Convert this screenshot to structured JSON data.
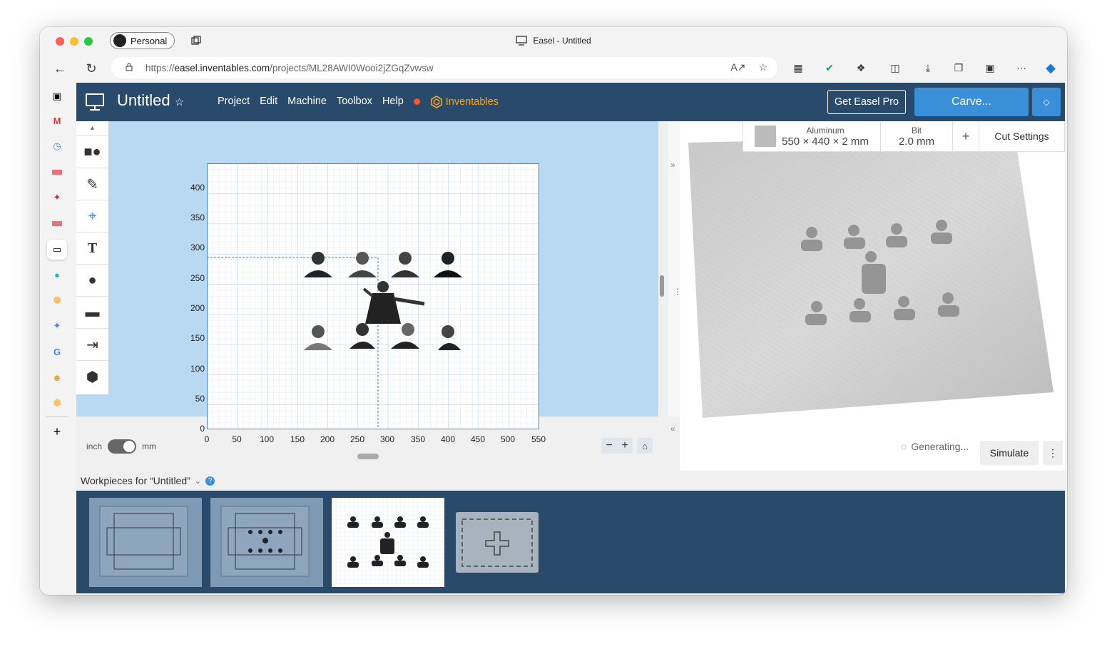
{
  "browser": {
    "window_title": "Easel - Untitled",
    "profile_label": "Personal",
    "url_prefix": "https://",
    "url_host": "easel.inventables.com",
    "url_path": "/projects/ML28AWI0Wooi2jZGqZvwsw"
  },
  "colors": {
    "appbar_bg": "#294a6b",
    "carve_button": "#3a8fd9",
    "canvas_bg": "#b9d8f2",
    "accent_orange": "#f5a623",
    "notification": "#f05a28"
  },
  "app": {
    "project_title": "Untitled",
    "menu": [
      "Project",
      "Edit",
      "Machine",
      "Toolbox",
      "Help"
    ],
    "brand_label": "Inventables",
    "get_pro_label": "Get Easel Pro",
    "carve_label": "Carve..."
  },
  "tools": [
    "shapes-icon",
    "pen-icon",
    "target-icon",
    "text-icon",
    "apple-icon",
    "lego-icon",
    "import-icon",
    "box-icon"
  ],
  "canvas": {
    "y_ticks": [
      "400",
      "350",
      "300",
      "250",
      "200",
      "150",
      "100",
      "50",
      "0"
    ],
    "x_ticks": [
      "0",
      "50",
      "100",
      "150",
      "200",
      "250",
      "300",
      "350",
      "400",
      "450",
      "500",
      "550"
    ],
    "unit_left": "inch",
    "unit_right": "mm",
    "unit_selected": "mm"
  },
  "material": {
    "name": "Aluminum",
    "dimensions": "550 × 440 × 2 mm",
    "bit_label": "Bit",
    "bit_value": "2.0 mm",
    "add_label": "+",
    "cut_settings_label": "Cut Settings"
  },
  "preview": {
    "status": "Generating...",
    "simulate_label": "Simulate"
  },
  "workpieces": {
    "header": "Workpieces for “Untitled”",
    "count": 3,
    "active_index": 2
  }
}
